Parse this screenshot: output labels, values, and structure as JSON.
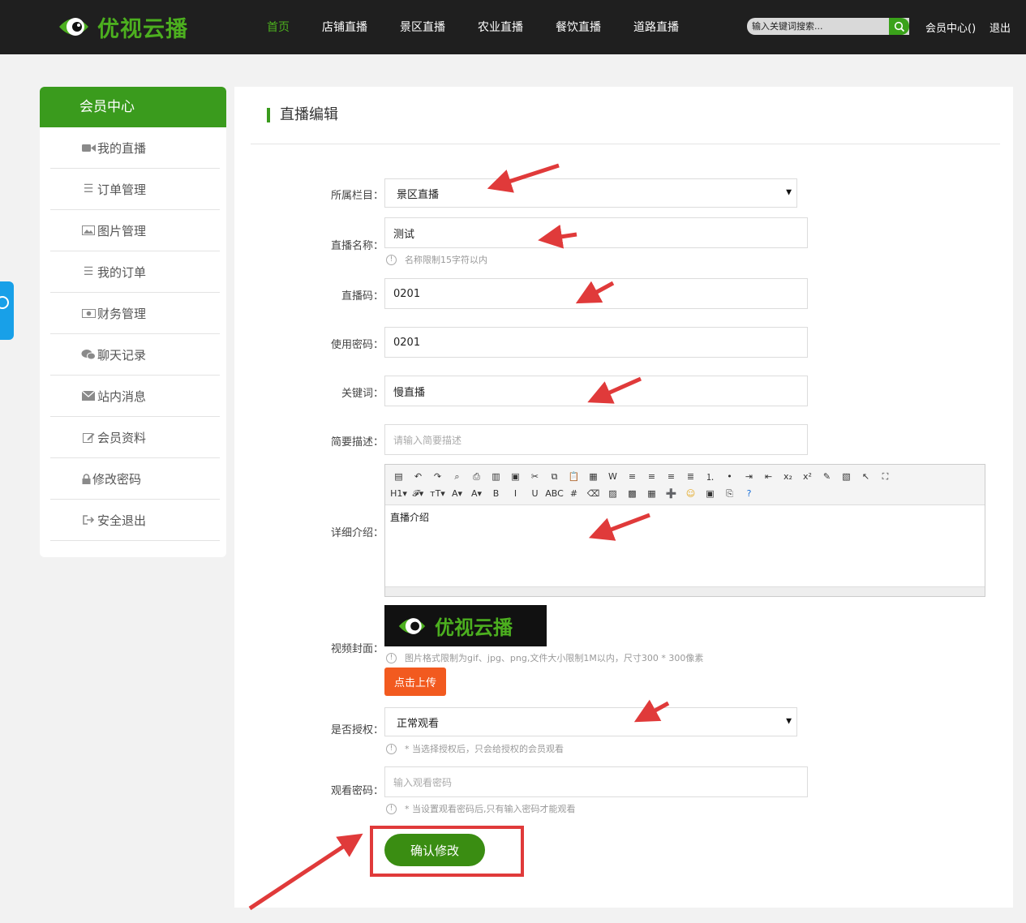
{
  "header": {
    "logo_text": "优视云播",
    "nav": [
      "首页",
      "店铺直播",
      "景区直播",
      "农业直播",
      "餐饮直播",
      "道路直播"
    ],
    "search_placeholder": "输入关键词搜索...",
    "member_center": "会员中心()",
    "logout": "退出",
    "accent": "#4caf1f"
  },
  "sidebar": {
    "title": "会员中心",
    "items": [
      {
        "label": "我的直播",
        "icon": "video-camera-icon"
      },
      {
        "label": "订单管理",
        "icon": "list-icon"
      },
      {
        "label": "图片管理",
        "icon": "image-icon"
      },
      {
        "label": "我的订单",
        "icon": "list-icon"
      },
      {
        "label": "财务管理",
        "icon": "money-icon"
      },
      {
        "label": "聊天记录",
        "icon": "wechat-icon"
      },
      {
        "label": "站内消息",
        "icon": "envelope-icon"
      },
      {
        "label": "会员资料",
        "icon": "edit-icon"
      },
      {
        "label": "修改密码",
        "icon": "lock-icon"
      },
      {
        "label": "安全退出",
        "icon": "sign-out-icon"
      }
    ]
  },
  "main": {
    "title": "直播编辑",
    "fields": {
      "category": {
        "label": "所属栏目：",
        "value": "景区直播"
      },
      "name": {
        "label": "直播名称：",
        "value": "测试",
        "hint": "名称限制15字符以内"
      },
      "code": {
        "label": "直播码：",
        "value": "0201"
      },
      "password": {
        "label": "使用密码：",
        "value": "0201"
      },
      "keywords": {
        "label": "关键词：",
        "value": "慢直播"
      },
      "summary": {
        "label": "简要描述：",
        "placeholder": "请输入简要描述"
      },
      "detail": {
        "label": "详细介绍：",
        "value": "直播介绍"
      },
      "cover": {
        "label": "视频封面：",
        "hint": "图片格式限制为gif、jpg、png,文件大小限制1M以内，尺寸300 * 300像素",
        "upload": "点击上传",
        "logo_text": "优视云播"
      },
      "auth": {
        "label": "是否授权：",
        "value": "正常观看",
        "hint": "* 当选择授权后，只会给授权的会员观看"
      },
      "view_password": {
        "label": "观看密码：",
        "placeholder": "输入观看密码",
        "hint": "* 当设置观看密码后,只有输入密码才能观看"
      }
    },
    "editor_toolbar": {
      "row1": [
        "source-icon",
        "undo-icon",
        "redo-icon",
        "preview-icon",
        "print-icon",
        "template-icon",
        "code-icon",
        "cut-icon",
        "copy-icon",
        "paste-icon",
        "paste-text-icon",
        "paste-word-icon",
        "align-left-icon",
        "align-center-icon",
        "align-right-icon",
        "justify-icon",
        "ordered-list-icon",
        "unordered-list-icon",
        "indent-icon",
        "outdent-icon",
        "subscript-icon",
        "superscript-icon",
        "clear-format-icon",
        "select-all-icon",
        "pointer-icon",
        "fullscreen-icon"
      ],
      "row2": [
        "H1▾",
        "𝓕▾",
        "тT▾",
        "A▾",
        "A▾",
        "B",
        "I",
        "U",
        "ABC",
        "#",
        "⌫",
        "image-insert-icon",
        "multi-image-icon",
        "table-icon",
        "hr-icon",
        "emoticon-icon",
        "picture-icon",
        "pagebreak-icon",
        "help-icon"
      ]
    },
    "submit": "确认修改",
    "annotation_color": "#e03a3a",
    "brand_green": "#3a9b1d",
    "upload_color": "#f25a1f"
  }
}
